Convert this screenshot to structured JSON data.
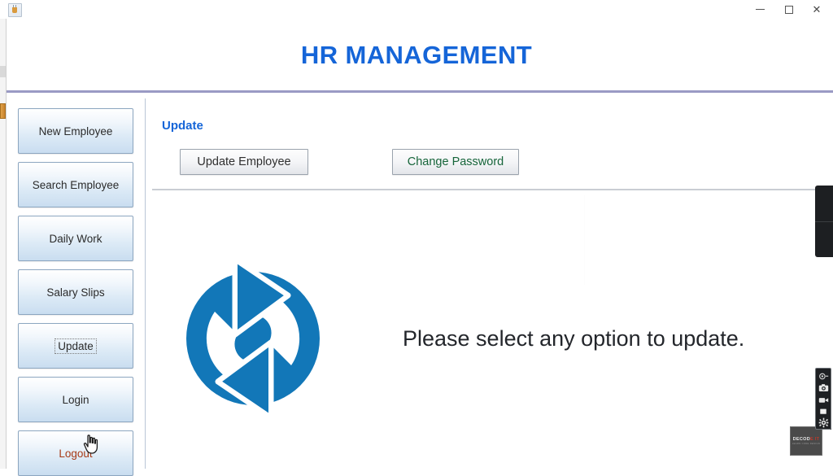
{
  "window": {
    "app_icon": "java-app-icon",
    "controls": {
      "minimize": "minimize-button",
      "maximize": "maximize-button",
      "close": "✕"
    }
  },
  "header": {
    "title": "HR MANAGEMENT",
    "title_color": "#1565D8"
  },
  "sidebar": {
    "items": [
      {
        "label": "New Employee",
        "state": "normal"
      },
      {
        "label": "Search Employee",
        "state": "normal"
      },
      {
        "label": "Daily Work",
        "state": "normal"
      },
      {
        "label": "Salary Slips",
        "state": "normal"
      },
      {
        "label": "Update",
        "state": "focused"
      },
      {
        "label": "Login",
        "state": "normal"
      },
      {
        "label": "Logout",
        "state": "danger"
      }
    ]
  },
  "content": {
    "section_heading": "Update",
    "buttons": [
      {
        "label": "Update Employee",
        "color": "#2f2f2f"
      },
      {
        "label": "Change Password",
        "color": "#16653a"
      }
    ],
    "message": "Please select any option to update.",
    "logo": {
      "name": "sync-refresh-logo",
      "color": "#1277B8"
    }
  },
  "overlay": {
    "recorder_toolbar": {
      "icons": [
        "webcam-icon",
        "screenshot-camera-icon",
        "video-camera-icon",
        "stop-square-icon",
        "settings-gear-icon"
      ]
    },
    "watermark": {
      "title_main": "DECOD",
      "title_accent": "E IT",
      "subtitle": "LEARN CODE DESIGN"
    }
  }
}
